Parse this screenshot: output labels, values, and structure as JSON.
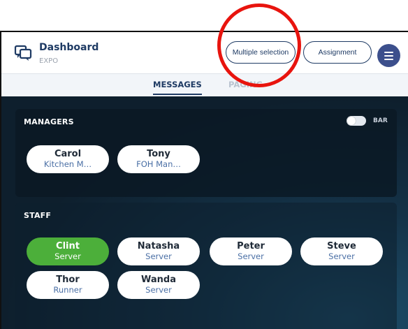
{
  "header": {
    "title": "Dashboard",
    "subtitle": "EXPO",
    "multiple_selection_label": "Multiple selection",
    "assignment_label": "Assignment"
  },
  "tabs": [
    {
      "label": "MESSAGES",
      "active": true
    },
    {
      "label": "PAGING",
      "active": false
    }
  ],
  "managers": {
    "title": "MANAGERS",
    "toggle_label": "BAR",
    "toggle_on": false,
    "people": [
      {
        "name": "Carol",
        "role": "Kitchen M…"
      },
      {
        "name": "Tony",
        "role": "FOH Man…"
      }
    ]
  },
  "staff": {
    "title": "STAFF",
    "people": [
      {
        "name": "Clint",
        "role": "Server",
        "selected": true
      },
      {
        "name": "Natasha",
        "role": "Server",
        "selected": false
      },
      {
        "name": "Peter",
        "role": "Server",
        "selected": false
      },
      {
        "name": "Steve",
        "role": "Server",
        "selected": false
      },
      {
        "name": "Thor",
        "role": "Runner",
        "selected": false
      },
      {
        "name": "Wanda",
        "role": "Server",
        "selected": false
      }
    ]
  },
  "colors": {
    "brand": "#1f3b64",
    "menu_button": "#3c4f8c",
    "selected_chip": "#4caf3a",
    "annotation": "#e8140e"
  },
  "icons": {
    "logo": "chat-bubbles-icon",
    "menu": "hamburger-menu-icon"
  }
}
